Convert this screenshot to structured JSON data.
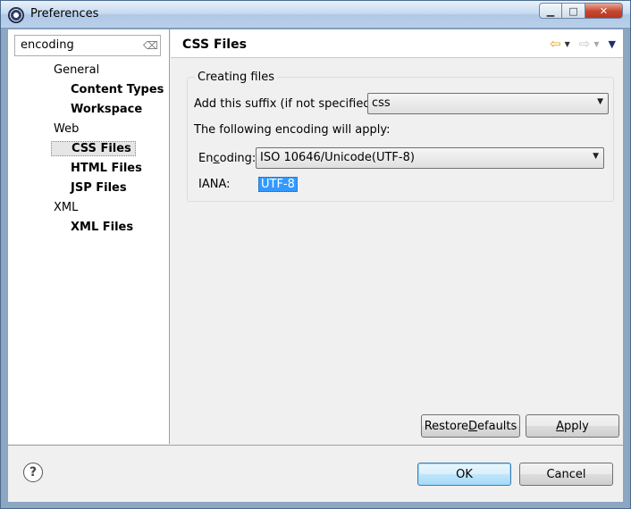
{
  "window": {
    "title": "Preferences",
    "controls": {
      "minimize": "▁",
      "maximize": "□",
      "close": "✕"
    }
  },
  "filter": {
    "value": "encoding",
    "clear_icon": "eraser-icon"
  },
  "tree": [
    {
      "label": "General",
      "kind": "category"
    },
    {
      "label": "Content Types",
      "kind": "leaf"
    },
    {
      "label": "Workspace",
      "kind": "leaf"
    },
    {
      "label": "Web",
      "kind": "category"
    },
    {
      "label": "CSS Files",
      "kind": "leaf",
      "selected": true
    },
    {
      "label": "HTML Files",
      "kind": "leaf"
    },
    {
      "label": "JSP Files",
      "kind": "leaf"
    },
    {
      "label": "XML",
      "kind": "category"
    },
    {
      "label": "XML Files",
      "kind": "leaf"
    }
  ],
  "page": {
    "title": "CSS Files",
    "nav": {
      "back": "⇦",
      "forward": "⇨",
      "caret": "▼",
      "menu": "▼"
    }
  },
  "group": {
    "title": "Creating files",
    "suffix_label": "Add this suffix (if not specified):",
    "suffix_value": "css",
    "encoding_note": "The following encoding will apply:",
    "encoding_label_pre": "En",
    "encoding_label_mnemonic": "c",
    "encoding_label_post": "oding:",
    "encoding_value": "ISO 10646/Unicode(UTF-8)",
    "iana_label": "IANA:",
    "iana_value": "UTF-8",
    "combo_arrow": "▼"
  },
  "buttons": {
    "restore_pre": "Restore ",
    "restore_mnemonic": "D",
    "restore_post": "efaults",
    "apply_mnemonic": "A",
    "apply_post": "pply",
    "ok": "OK",
    "cancel": "Cancel"
  },
  "help": {
    "glyph": "?"
  },
  "colors": {
    "selection": "#3399ff",
    "back_arrow": "#e3a21a"
  }
}
